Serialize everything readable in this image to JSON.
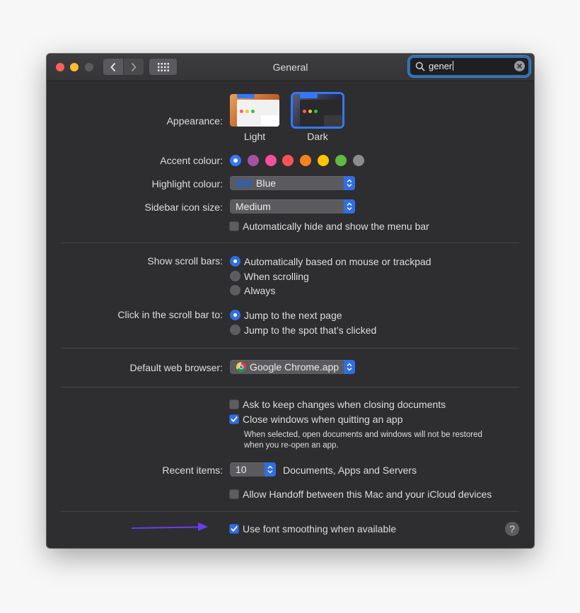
{
  "window": {
    "title": "General",
    "search": {
      "value": "gener"
    }
  },
  "appearance": {
    "label": "Appearance:",
    "options": [
      {
        "name": "Light",
        "selected": false
      },
      {
        "name": "Dark",
        "selected": true
      }
    ]
  },
  "accent": {
    "label": "Accent colour:",
    "colors": [
      "#3478f6",
      "#a550a7",
      "#f74f9e",
      "#ff5257",
      "#f7821b",
      "#ffc600",
      "#62ba46",
      "#8c8c8c"
    ],
    "selected_index": 0
  },
  "highlight": {
    "label": "Highlight colour:",
    "value": "Blue",
    "swatch": "#3a5f9a"
  },
  "sidebar_size": {
    "label": "Sidebar icon size:",
    "value": "Medium"
  },
  "menubar": {
    "label": "Automatically hide and show the menu bar",
    "checked": false
  },
  "scroll_bars": {
    "label": "Show scroll bars:",
    "options": [
      {
        "label": "Automatically based on mouse or trackpad",
        "selected": true
      },
      {
        "label": "When scrolling",
        "selected": false
      },
      {
        "label": "Always",
        "selected": false
      }
    ]
  },
  "scroll_click": {
    "label": "Click in the scroll bar to:",
    "options": [
      {
        "label": "Jump to the next page",
        "selected": true
      },
      {
        "label": "Jump to the spot that’s clicked",
        "selected": false
      }
    ]
  },
  "browser": {
    "label": "Default web browser:",
    "value": "Google Chrome.app"
  },
  "documents": {
    "ask_keep": {
      "label": "Ask to keep changes when closing documents",
      "checked": false
    },
    "close_windows": {
      "label": "Close windows when quitting an app",
      "checked": true
    },
    "note_line1": "When selected, open documents and windows will not be restored",
    "note_line2": "when you re-open an app."
  },
  "recent": {
    "label": "Recent items:",
    "value": "10",
    "suffix": "Documents, Apps and Servers"
  },
  "handoff": {
    "label": "Allow Handoff between this Mac and your iCloud devices",
    "checked": false
  },
  "smoothing": {
    "label": "Use font smoothing when available",
    "checked": true
  },
  "help": {
    "glyph": "?"
  },
  "colors": {
    "checkbox_on": "#2f6fe0",
    "annotation_arrow": "#6a3df0"
  }
}
